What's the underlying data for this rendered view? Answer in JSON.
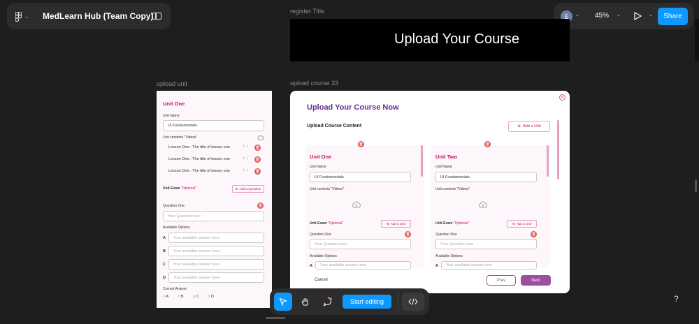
{
  "topbar": {
    "file_name": "MedLearn Hub (Team Copy)",
    "avatar_initial": "E",
    "zoom": "45%",
    "share_label": "Share"
  },
  "frames": {
    "register_title": {
      "label": "register Title",
      "heading": "Upload Your Course"
    },
    "upload_unit": {
      "label": "upload unit",
      "unit_title": "Unit One",
      "unit_name_label": "Unit Name",
      "unit_name_value": "UI Fundamentals",
      "unit_contents_label": "Unit contents \"Videos\"",
      "lessons": [
        "Lesson One : The title of lesson one",
        "Lesson One : The title of lesson one",
        "Lesson One : The title of lesson one"
      ],
      "unit_exam_label": "Unit Exam",
      "optional_label": "\"Optional\"",
      "add_question_label": "Add a Question",
      "question_label": "Question One",
      "question_placeholder": "Your Question here",
      "available_options_label": "Available Options",
      "options": [
        {
          "letter": "A",
          "placeholder": "Your available answer here"
        },
        {
          "letter": "B",
          "placeholder": "Your available answer here"
        },
        {
          "letter": "C",
          "placeholder": "Your available answer here"
        },
        {
          "letter": "D",
          "placeholder": "Your available answer here"
        }
      ],
      "correct_answer_label": "Correct Answer",
      "correct_choices": [
        "A",
        "B",
        "C",
        "D"
      ]
    },
    "upload_course": {
      "label": "upload course 33",
      "modal_title": "Upload Your Course Now",
      "section_title": "Upload Course Content",
      "add_unit_label": "Add a Unit",
      "units": [
        {
          "title": "Unit One",
          "unit_name_label": "Unit Name",
          "unit_name_value": "UI Fundamentals",
          "contents_label": "Unit contents \"Videos\"",
          "exam_label": "Unit Exam",
          "optional_label": "\"Optional\"",
          "add_unit_label": "Add a Unit",
          "question_label": "Question One",
          "question_placeholder": "Your Question here",
          "available_options_label": "Available Options",
          "option_letter": "A",
          "option_placeholder": "Your available answer here"
        },
        {
          "title": "Unit Two",
          "unit_name_label": "Unit Name",
          "unit_name_value": "UI Fundamentals",
          "contents_label": "Unit contents \"Videos\"",
          "exam_label": "Unit Exam",
          "optional_label": "\"Optional\"",
          "add_unit_label": "Add a Unit",
          "question_label": "Question One",
          "question_placeholder": "Your Question here",
          "available_options_label": "Available Options",
          "option_letter": "A",
          "option_placeholder": "Your available answer here"
        }
      ],
      "cancel_label": "Cancel",
      "prev_label": "Prev",
      "next_label": "Next"
    }
  },
  "toolbar": {
    "start_editing_label": "Start editing"
  },
  "help_label": "?",
  "colors": {
    "accent_blue": "#0d99ff",
    "pink": "#c2185b",
    "purple": "#6a2c91",
    "next_button": "#9b4f9e",
    "delete_red": "#e05a5a"
  }
}
